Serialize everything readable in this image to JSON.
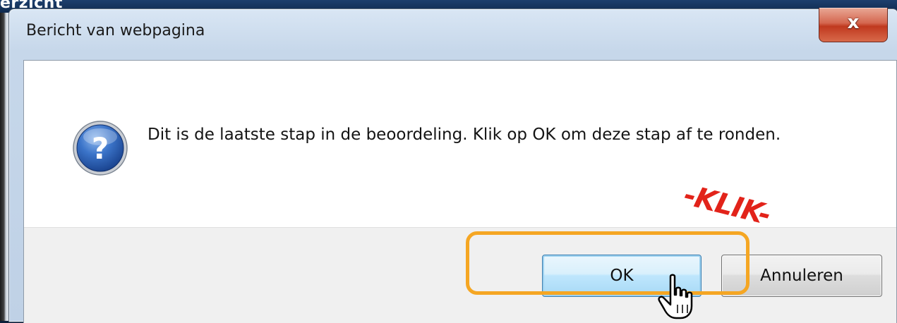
{
  "background": {
    "title_fragment": "erzicht"
  },
  "dialog": {
    "title": "Bericht van webpagina",
    "close_label": "x",
    "message": "Dit is de laatste stap in de beoordeling. Klik op OK om deze stap af te ronden.",
    "icon": "question-icon",
    "buttons": {
      "ok": "OK",
      "cancel": "Annuleren"
    }
  },
  "annotation": {
    "callout": "-KLIK-",
    "highlight_color": "#f5a623",
    "callout_color": "#e2231a"
  },
  "colors": {
    "icon_blue": "#2a62b8",
    "close_red": "#c0391f"
  }
}
